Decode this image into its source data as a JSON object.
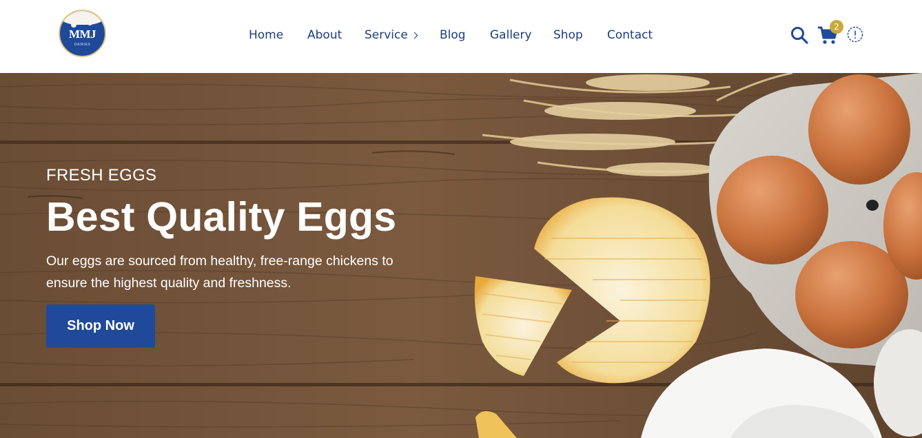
{
  "brand": {
    "logo_text": "MMJ",
    "logo_subtext": "DAIRIES"
  },
  "nav": {
    "items": [
      {
        "label": "Home"
      },
      {
        "label": "About"
      },
      {
        "label": "Service"
      },
      {
        "label": "Blog"
      },
      {
        "label": "Gallery"
      },
      {
        "label": "Shop"
      },
      {
        "label": "Contact"
      }
    ]
  },
  "header_icons": {
    "search": "search-icon",
    "cart": "cart-icon",
    "cart_count": "2",
    "info": "info-icon"
  },
  "hero": {
    "eyebrow": "FRESH EGGS",
    "headline": "Best Quality Eggs",
    "description": "Our eggs are sourced from healthy, free-range chickens to ensure the highest quality and freshness.",
    "cta_label": "Shop Now"
  },
  "colors": {
    "brand_blue": "#1f4a9a",
    "nav_text": "#1d3c7a",
    "badge_gold": "#c9a93b",
    "wood_brown": "#6f5138"
  }
}
